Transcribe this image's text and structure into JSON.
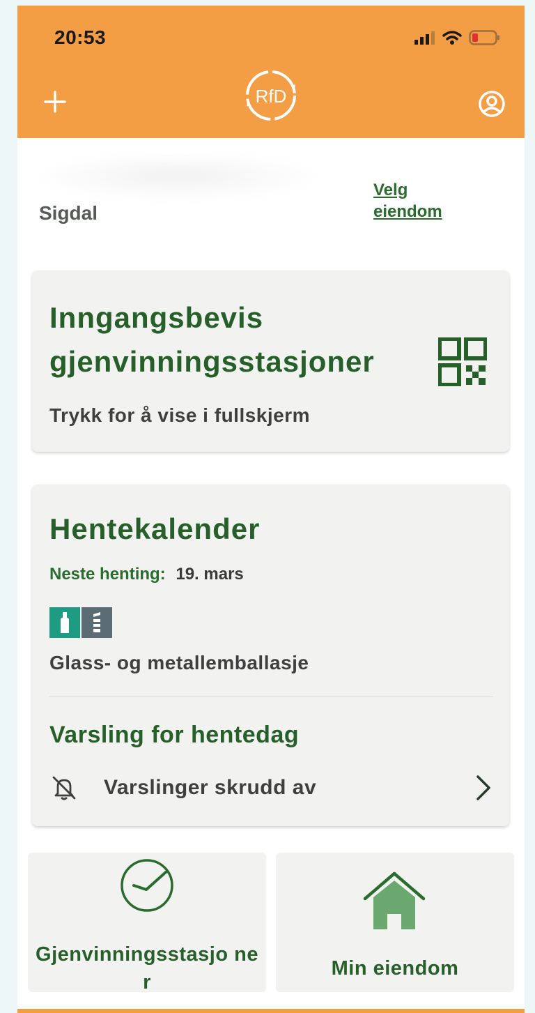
{
  "status_bar": {
    "time": "20:53"
  },
  "header": {
    "logo_text": "RfD"
  },
  "property": {
    "municipality": "Sigdal",
    "choose_link": "Velg eiendom"
  },
  "entry_pass": {
    "title": "Inngangsbevis gjenvinningsstasjoner",
    "subtitle": "Trykk for å vise i fullskjerm"
  },
  "calendar": {
    "title": "Hentekalender",
    "next_label": "Neste henting:",
    "next_date": "19. mars",
    "fraction_name": "Glass- og metallemballasje",
    "notification_title": "Varsling for hentedag",
    "notification_status": "Varslinger skrudd av"
  },
  "tiles": {
    "stations_label": "Gjenvinningsstasjo ner",
    "property_label": "Min eiendom"
  },
  "colors": {
    "brand_orange": "#f39d45",
    "brand_green": "#265f29",
    "glass_color": "#1e9c83",
    "metal_color": "#5b6c74"
  }
}
